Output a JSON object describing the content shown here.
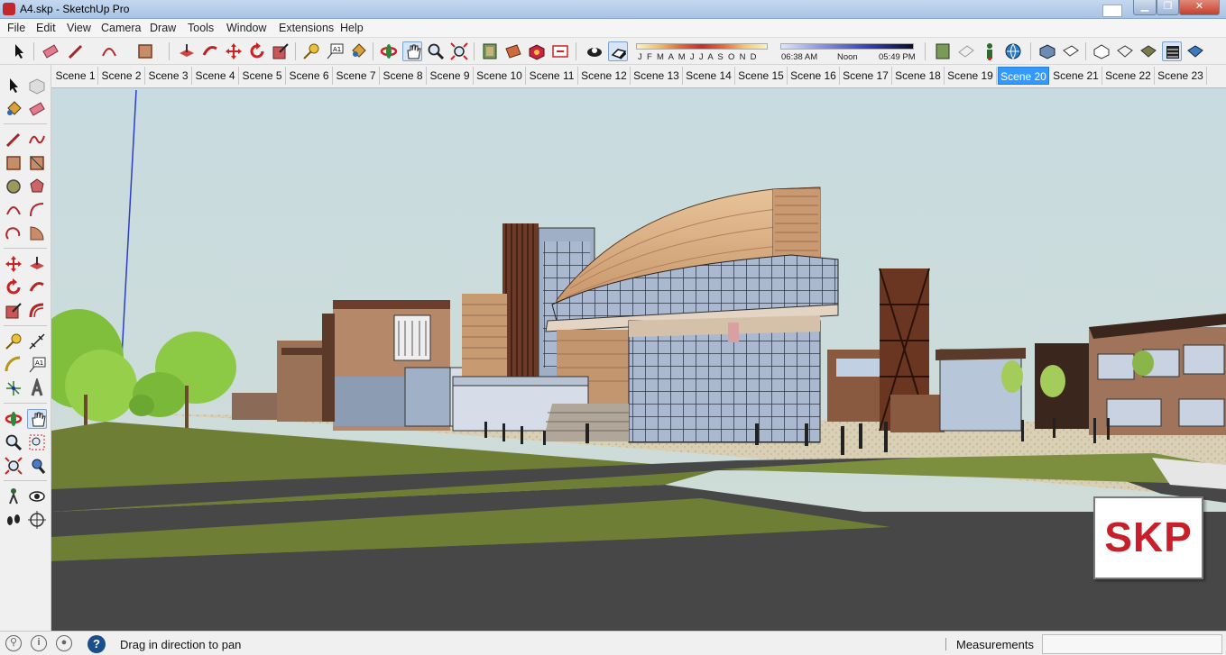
{
  "window": {
    "title": "A4.skp - SketchUp Pro",
    "min": "▁",
    "max": "❐",
    "close": "✕"
  },
  "menu": [
    "File",
    "Edit",
    "View",
    "Camera",
    "Draw",
    "Tools",
    "Window",
    "Extensions",
    "Help"
  ],
  "toolbar": {
    "icons": [
      "select-icon",
      "eraser-icon",
      "pencil-line-icon",
      "arc-icon",
      "rectangle-icon",
      "push-pull-icon",
      "follow-me-icon",
      "move-icon",
      "rotate-icon",
      "scale-icon",
      "tape-measure-icon",
      "text-icon",
      "paint-bucket-icon",
      "orbit-icon",
      "pan-icon",
      "zoom-icon",
      "zoom-extents-icon",
      "previous-view-icon",
      "section-plane-icon",
      "components-icon",
      "3d-warehouse-icon",
      "display-shadows-icon",
      "shadow-toggle-icon"
    ],
    "shadow": {
      "months": "J F M A M J J A S O N D",
      "time_start": "06:38 AM",
      "time_mid": "Noon",
      "time_end": "05:49 PM"
    },
    "view_icons": [
      "iso-view-icon",
      "top-view-icon",
      "front-view-icon",
      "right-view-icon",
      "back-view-icon",
      "left-view-icon",
      "xray-icon",
      "back-edges-icon",
      "wireframe-icon",
      "hidden-line-icon",
      "shaded-icon",
      "shaded-textures-icon",
      "monochrome-icon"
    ]
  },
  "scenes": {
    "tabs": [
      "Scene 1",
      "Scene 2",
      "Scene 3",
      "Scene 4",
      "Scene 5",
      "Scene 6",
      "Scene 7",
      "Scene 8",
      "Scene 9",
      "Scene 10",
      "Scene 11",
      "Scene 12",
      "Scene 13",
      "Scene 14",
      "Scene 15",
      "Scene 16",
      "Scene 17",
      "Scene 18",
      "Scene 19",
      "Scene 20",
      "Scene 21",
      "Scene 22",
      "Scene 23"
    ],
    "active": "Scene 20"
  },
  "viewport": {
    "watermark": "SKP",
    "sky_color": "#c5d6d8",
    "grass_color": "#6e7f35",
    "road_color": "#474747"
  },
  "status": {
    "info_icons": [
      "geo-location-icon",
      "credits-icon",
      "user-account-icon"
    ],
    "help": "?",
    "message": "Drag in direction to pan",
    "measurements_label": "Measurements",
    "measurements_value": ""
  }
}
